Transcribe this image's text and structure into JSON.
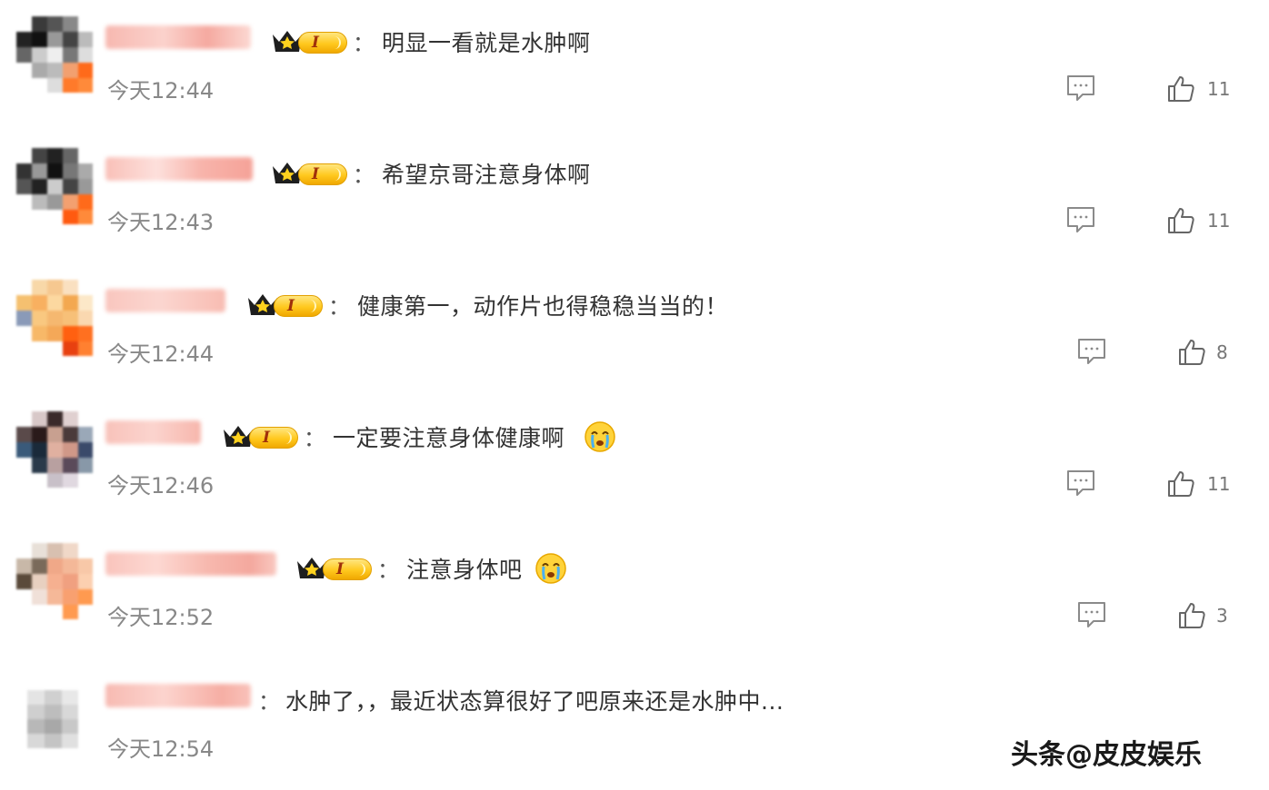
{
  "comments": [
    {
      "text": "明显一看就是水肿啊",
      "time": "今天12:44",
      "likes": "11",
      "has_badge": true,
      "emoji": ""
    },
    {
      "text": "希望京哥注意身体啊",
      "time": "今天12:43",
      "likes": "11",
      "has_badge": true,
      "emoji": ""
    },
    {
      "text": "健康第一，动作片也得稳稳当当的！",
      "time": "今天12:44",
      "likes": "8",
      "has_badge": true,
      "emoji": ""
    },
    {
      "text": "一定要注意身体健康啊",
      "time": "今天12:46",
      "likes": "11",
      "has_badge": true,
      "emoji": "crying-face"
    },
    {
      "text": "注意身体吧",
      "time": "今天12:52",
      "likes": "3",
      "has_badge": true,
      "emoji": "crying-face"
    },
    {
      "text": "水肿了，，最近状态算很好了吧原来还是水肿中...",
      "time": "今天12:54",
      "likes": "",
      "has_badge": false,
      "emoji": ""
    }
  ],
  "badge_label": "I",
  "colon": "：",
  "icons": {
    "reply": "comment-bubble-icon",
    "like": "thumbs-up-icon",
    "badge": "crown-icon"
  },
  "colors": {
    "badge_gold": "#ffc81e",
    "text": "#333333",
    "time": "#888888"
  },
  "watermark": "头条@皮皮娱乐"
}
